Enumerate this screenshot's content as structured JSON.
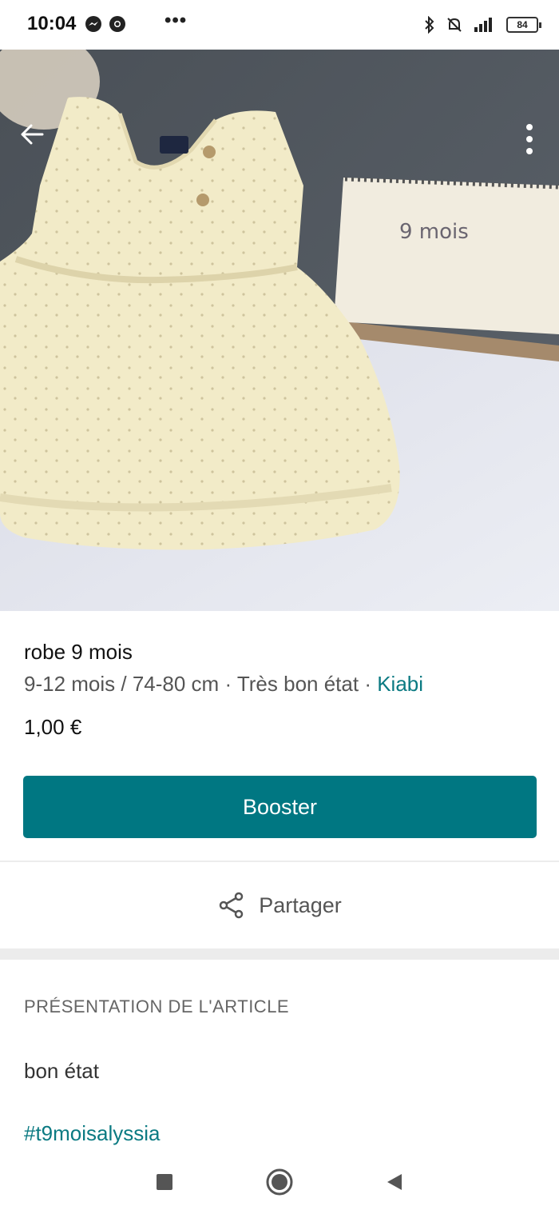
{
  "status_bar": {
    "time": "10:04",
    "battery": "84",
    "more": "•••"
  },
  "photo": {
    "note_text": "9 mois"
  },
  "item": {
    "title": "robe 9 mois",
    "size": "9-12 mois / 74-80 cm",
    "separator": " · ",
    "condition": "Très bon état",
    "brand": "Kiabi",
    "price": "1,00 €"
  },
  "actions": {
    "booster_label": "Booster",
    "share_label": "Partager"
  },
  "presentation": {
    "section_title": "PRÉSENTATION DE L'ARTICLE",
    "description": "bon état",
    "hashtag": "#t9moisalyssia"
  },
  "colors": {
    "accent": "#007782",
    "link": "#0b7a82"
  },
  "icons": [
    "back-arrow-icon",
    "more-vertical-icon",
    "share-icon",
    "messenger-icon",
    "chrome-icon",
    "bluetooth-icon",
    "mute-icon",
    "signal-icon",
    "battery-icon",
    "nav-square-icon",
    "nav-home-icon",
    "nav-back-icon"
  ]
}
